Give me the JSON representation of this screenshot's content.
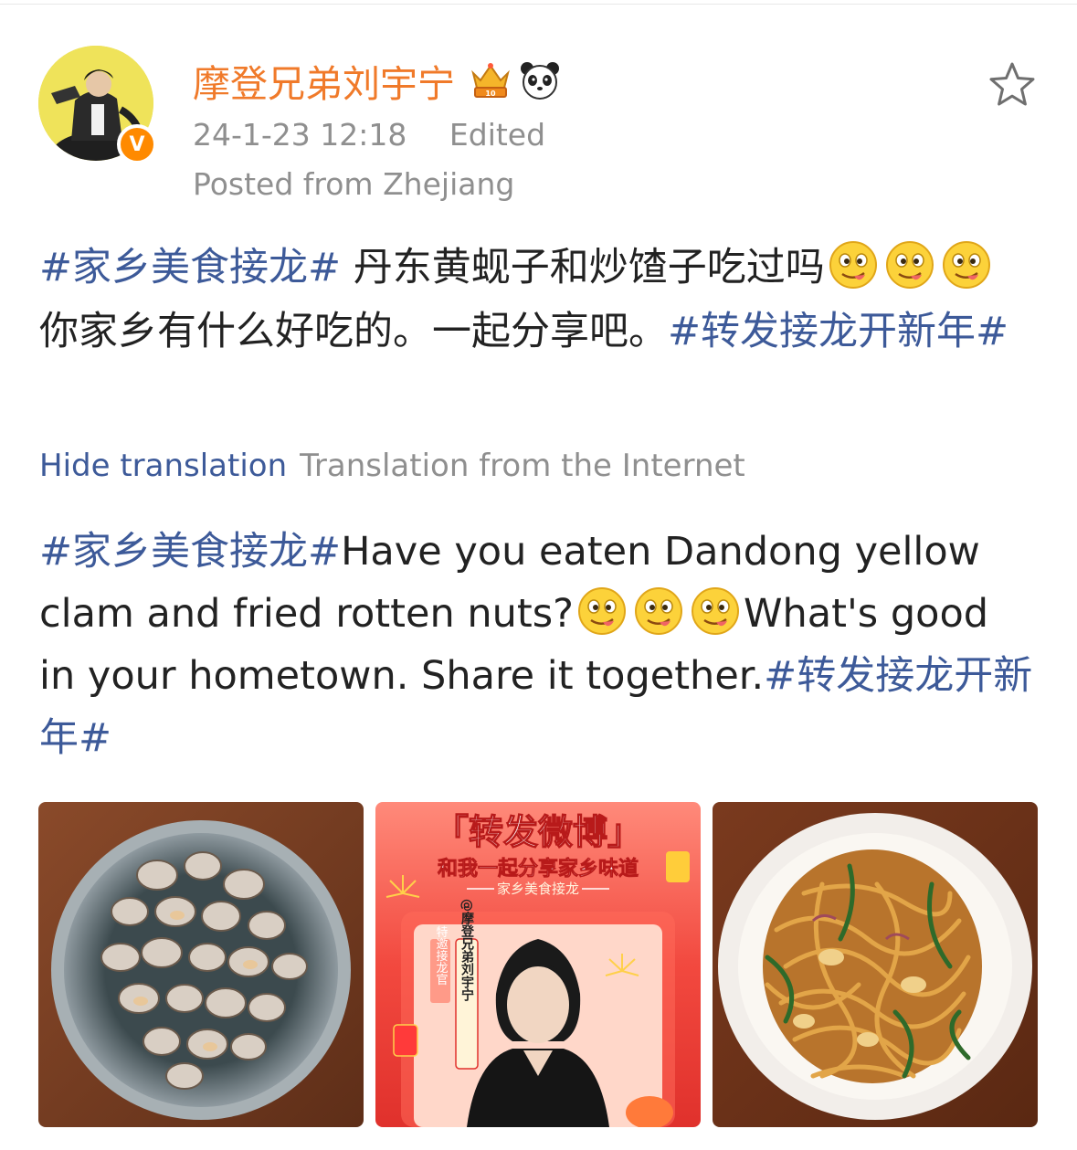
{
  "post": {
    "username": "摩登兄弟刘宇宁",
    "timestamp": "24-1-23 12:18",
    "edited_label": "Edited",
    "location": "Posted from Zhejiang",
    "original": {
      "tag1": "#家乡美食接龙#",
      "text1": " 丹东黄蚬子和炒馇子吃过吗",
      "text2": "你家乡有什么好吃的。一起分享吧。",
      "tag2": "#转发接龙开新年#"
    },
    "translation_controls": {
      "hide_label": "Hide translation",
      "source_label": "Translation from the Internet"
    },
    "translation": {
      "tag1": "#家乡美食接龙#",
      "text1": "Have you eaten Dandong yellow clam and fried rotten nuts?",
      "text2": "What's good in your hometown. Share it together.",
      "tag2": "#转发接龙开新年#"
    },
    "images": [
      {
        "icon": "clams-photo"
      },
      {
        "icon": "promo-poster",
        "headline": "「转发微博」",
        "subhead": "和我一起分享家乡味道",
        "strip": "家乡美食接龙",
        "side_label": "特邀接龙官",
        "name_label": "@摩登兄弟刘宇宁"
      },
      {
        "icon": "fried-noodles-photo"
      }
    ],
    "badges": [
      "crown-badge-icon",
      "panda-badge-icon"
    ],
    "verified_badge": "V"
  },
  "colors": {
    "username": "#f07a2a",
    "hashtag": "#3d5a99",
    "meta": "#8f8f8f",
    "text": "#222222"
  }
}
